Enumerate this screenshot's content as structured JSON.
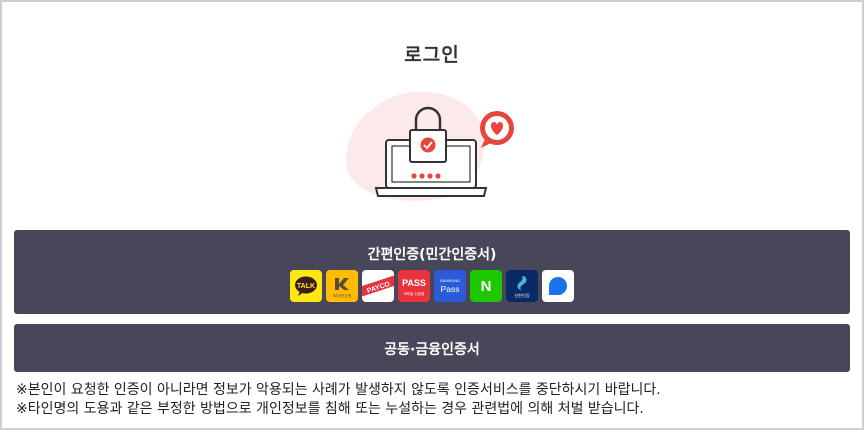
{
  "page": {
    "title": "로그인"
  },
  "simple_auth": {
    "label": "간편인증(민간인증서)",
    "providers": [
      {
        "name": "kakao-icon",
        "text": "TALK",
        "bg": "#FFE812"
      },
      {
        "name": "kb-icon",
        "text": "KB국민은행",
        "bg": "#FFBC00"
      },
      {
        "name": "payco-icon",
        "text": "PAYCO",
        "bg": "#FFFFFF"
      },
      {
        "name": "pass-icon",
        "text": "PASS",
        "sub": "모바일 신분증",
        "bg": "#E8323C"
      },
      {
        "name": "samsung-pass-icon",
        "text": "Pass",
        "sub": "SAMSUNG",
        "bg": "#2D5BD7"
      },
      {
        "name": "naver-icon",
        "text": "N",
        "bg": "#1EC800"
      },
      {
        "name": "shinhan-icon",
        "text": "신한인증",
        "bg": "#0A2A66"
      },
      {
        "name": "toss-icon",
        "text": "",
        "bg": "#FFFFFF"
      }
    ]
  },
  "cert_auth": {
    "label": "공동·금융인증서"
  },
  "notices": [
    "※본인이 요청한 인증이 아니라면 정보가 악용되는 사례가 발생하지 않도록 인증서비스를 중단하시기 바랍니다.",
    "※타인명의 도용과 같은 부정한 방법으로 개인정보를 침해 또는 누설하는 경우 관련법에 의해 처벌 받습니다."
  ],
  "colors": {
    "button_bg": "#474759",
    "accent": "#E8453C"
  }
}
